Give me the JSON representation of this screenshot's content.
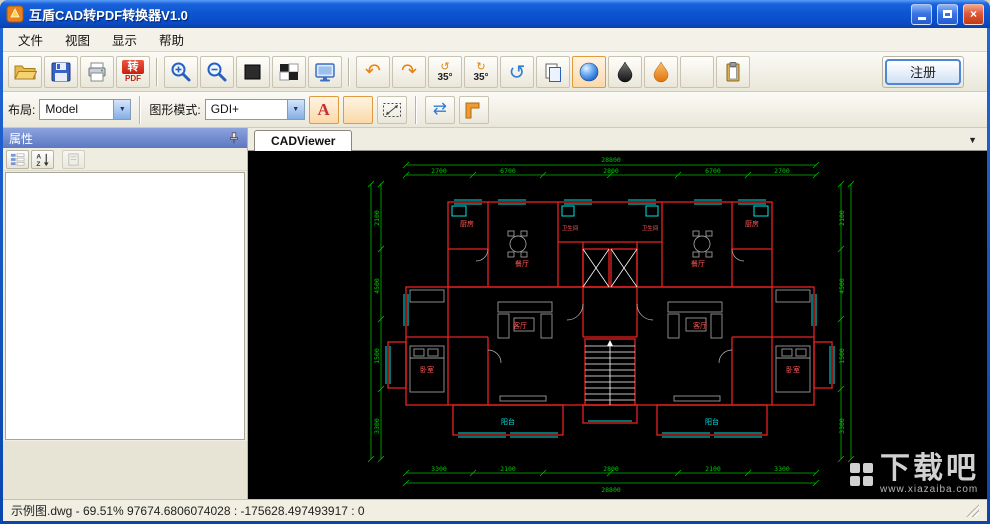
{
  "window": {
    "title": "互盾CAD转PDF转换器V1.0"
  },
  "menu": {
    "items": [
      "文件",
      "视图",
      "显示",
      "帮助"
    ]
  },
  "toolbar": {
    "pdf_icon_top": "转",
    "pdf_icon_bottom": "PDF",
    "rotate_left_label": "35°",
    "rotate_right_label": "35°",
    "register_label": "注册"
  },
  "toolbar2": {
    "layout_label": "布局:",
    "layout_value": "Model",
    "mode_label": "图形模式:",
    "mode_value": "GDI+"
  },
  "icons": {
    "undo": "↶",
    "redo": "↷",
    "rotate_ccw_small": "↺",
    "rotate_cw_small": "↻",
    "rotate_view": "↺",
    "swap": "⇄",
    "combo_arrow": "▼",
    "viewer_menu_arrow": "▼",
    "letter_a": "A",
    "sort_a": "A",
    "sort_z": "Z"
  },
  "sidebar": {
    "title": "属性"
  },
  "viewer": {
    "tab_label": "CADViewer"
  },
  "statusbar": {
    "text": "示例图.dwg  -  69.51% 97674.6806074028  :  -175628.497493917  :  0"
  },
  "watermark": {
    "title": "下载吧",
    "url": "www.xiazaiba.com"
  },
  "colors": {
    "wall": "#E82222",
    "window_cyan": "#00E5E5",
    "dimension_green": "#00BB00",
    "accent_orange": "#E8820C",
    "titlebar_blue": "#0C55D0"
  },
  "drawing": {
    "dims_top_total": "28800",
    "dims_top": [
      "2700",
      "6700",
      "2800",
      "6700",
      "2700"
    ],
    "dims_bottom": [
      "3300",
      "2100",
      "2800",
      "2100",
      "3300"
    ],
    "dims_bottom_total": "28800",
    "dims_left": [
      "2100",
      "4500",
      "1500",
      "3300"
    ],
    "dims_right": [
      "2100",
      "4500",
      "1500",
      "3300"
    ],
    "rooms": {
      "kitchen": "厨房",
      "bath": "卫生间",
      "dining": "餐厅",
      "living": "客厅",
      "bedroom": "卧室",
      "balcony": "阳台"
    }
  }
}
